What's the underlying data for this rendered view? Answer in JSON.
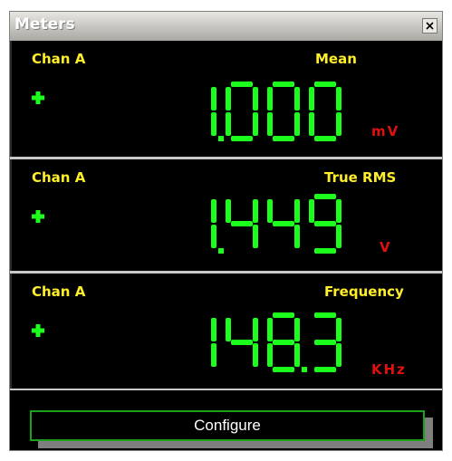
{
  "window": {
    "title": "Meters"
  },
  "meters": [
    {
      "channel": "Chan A",
      "measurement": "Mean",
      "value": "1.000",
      "unit": "mV"
    },
    {
      "channel": "Chan A",
      "measurement": "True RMS",
      "value": "1.449",
      "unit": "V"
    },
    {
      "channel": "Chan A",
      "measurement": "Frequency",
      "value": "148.3",
      "unit": "KHz"
    }
  ],
  "configure_label": "Configure",
  "colors": {
    "lcd_green": "#1cff1c",
    "label_yellow": "#ffef2a",
    "unit_red": "#e01010",
    "background": "#000000"
  },
  "icons": {
    "close": "close-icon",
    "plus": "plus-icon"
  }
}
